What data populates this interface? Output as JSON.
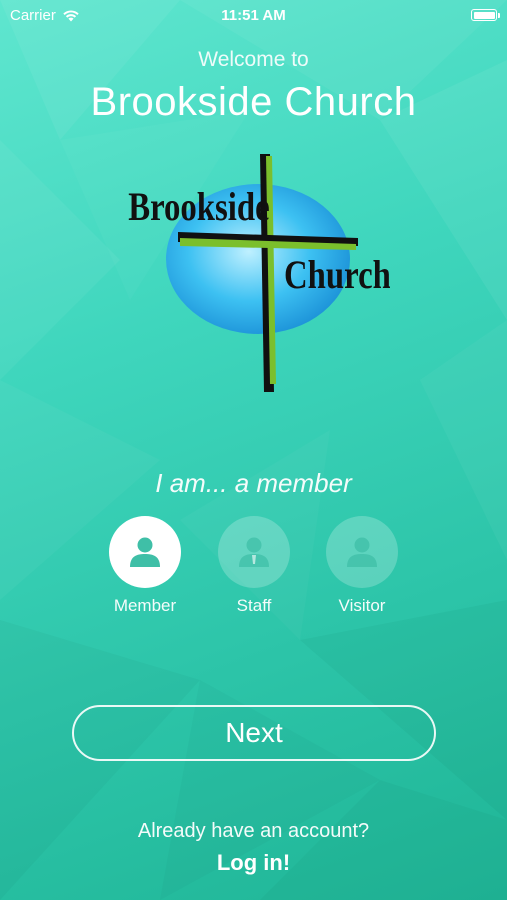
{
  "status_bar": {
    "carrier": "Carrier",
    "time": "11:51 AM",
    "icons": [
      "wifi-icon",
      "battery-icon"
    ]
  },
  "header": {
    "welcome": "Welcome to",
    "title": "Brookside Church"
  },
  "logo": {
    "word_top": "Brookside",
    "word_bottom": "Church"
  },
  "selection": {
    "prompt": "I am... a member",
    "roles": [
      {
        "label": "Member",
        "icon": "member-person-icon",
        "selected": true
      },
      {
        "label": "Staff",
        "icon": "staff-person-icon",
        "selected": false
      },
      {
        "label": "Visitor",
        "icon": "visitor-person-icon",
        "selected": false
      }
    ]
  },
  "actions": {
    "next_label": "Next",
    "account_prompt": "Already have an account?",
    "login_label": "Log in!"
  },
  "colors": {
    "background_light": "#5fe6cf",
    "background_dark": "#1fb596",
    "icon_teal": "#3fbfa7",
    "logo_blue": "#2fb7ef",
    "cross_green": "#7bbf2c"
  }
}
